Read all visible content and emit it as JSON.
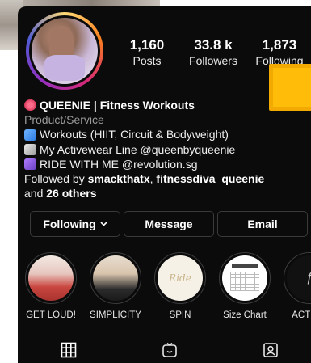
{
  "profile": {
    "stats": {
      "posts": {
        "value": "1,160",
        "label": "Posts"
      },
      "followers": {
        "value": "33.8 k",
        "label": "Followers"
      },
      "following": {
        "value": "1,873",
        "label": "Following"
      }
    },
    "bio": {
      "name": "QUEENIE | Fitness Workouts",
      "category": "Product/Service",
      "lines": [
        "Workouts (HIIT, Circuit & Bodyweight)",
        "My Activewear Line @queenbyqueenie",
        "RIDE WITH ME  @revolution.sg"
      ],
      "followed_by_prefix": "Followed by",
      "followed_by_1": "smackthatx",
      "followed_by_sep": ",",
      "followed_by_2": "fitnessdiva_queenie",
      "followed_by_and": "and",
      "followed_by_others": "26 others"
    }
  },
  "actions": {
    "following": "Following",
    "message": "Message",
    "email": "Email"
  },
  "highlights": [
    {
      "label": "GET LOUD!"
    },
    {
      "label": "SIMPLICITY"
    },
    {
      "label": "SPIN",
      "thumb_text": "Ride"
    },
    {
      "label": "Size Chart",
      "thumb_text": "SIZE CHART"
    },
    {
      "label": "ACTION"
    }
  ],
  "tabs": [
    {
      "icon": "grid-icon"
    },
    {
      "icon": "reels-icon"
    },
    {
      "icon": "tagged-icon"
    }
  ],
  "colors": {
    "background": "#0b0b0b",
    "text": "#ffffff",
    "secondary_text": "#9a9a9a",
    "button_border": "#3a3a3a",
    "sticker": "#ffbd0a"
  }
}
